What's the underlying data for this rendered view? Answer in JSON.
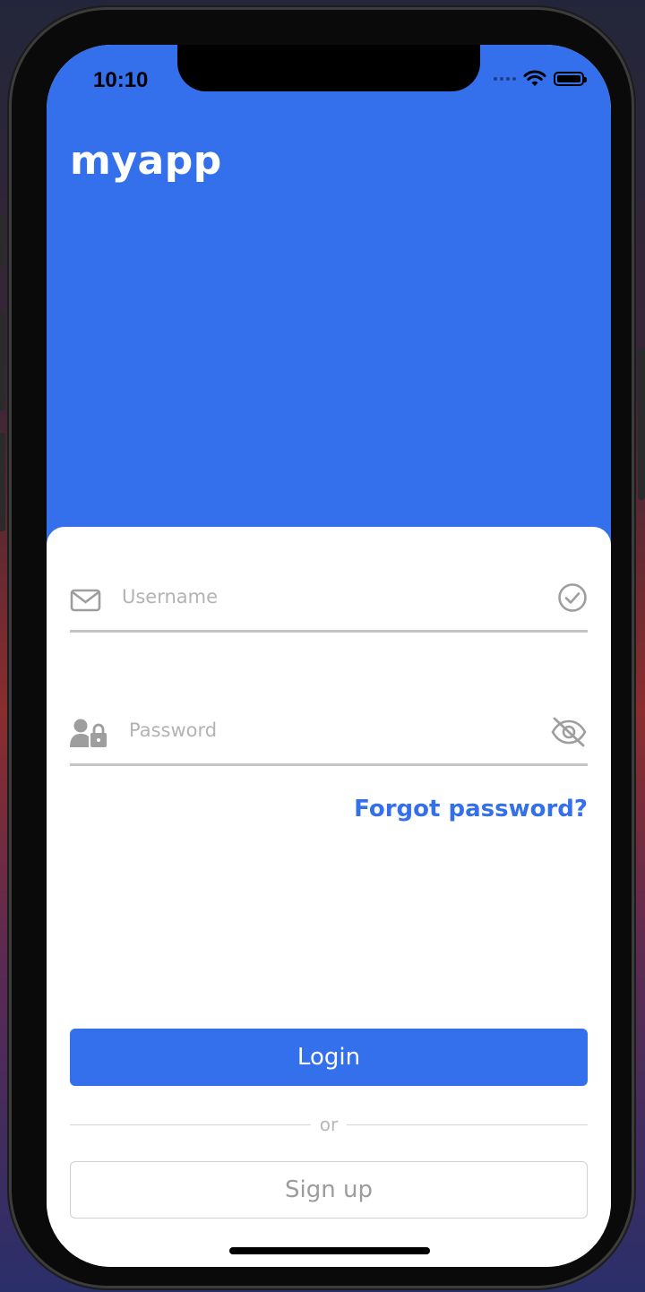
{
  "status_bar": {
    "time": "10:10",
    "icons": [
      "signal-dots-icon",
      "wifi-icon",
      "battery-icon"
    ]
  },
  "header": {
    "app_title": "myapp",
    "background_color": "#3470ec"
  },
  "login_form": {
    "username": {
      "placeholder": "Username",
      "left_icon": "envelope-icon",
      "right_icon": "check-circle-icon"
    },
    "password": {
      "placeholder": "Password",
      "left_icon": "user-lock-icon",
      "right_icon": "eye-slash-icon"
    },
    "forgot_password_label": "Forgot password?",
    "login_label": "Login",
    "divider_label": "or",
    "signup_label": "Sign up"
  },
  "colors": {
    "accent": "#3470ec",
    "placeholder": "#b3b3b3",
    "secondary_text": "#9c9c9c"
  }
}
